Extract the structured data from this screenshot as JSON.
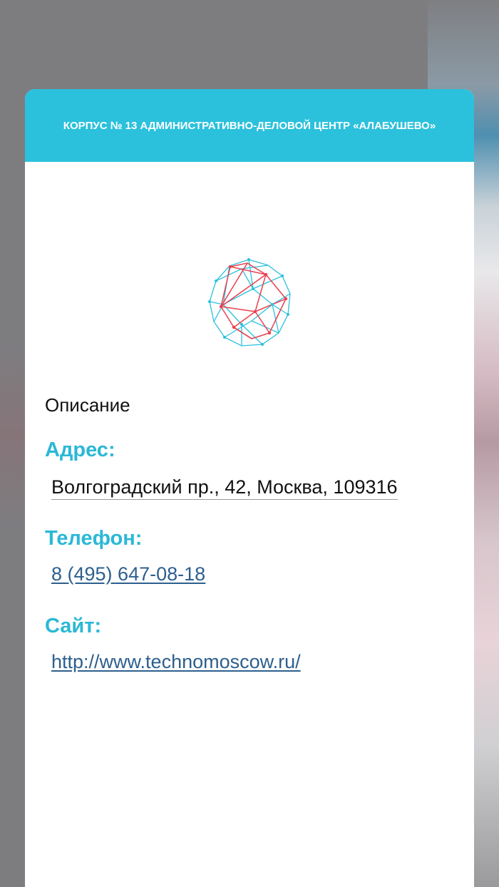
{
  "header": {
    "title": "КОРПУС № 13 АДМИНИСТРАТИВНО-ДЕЛОВОЙ ЦЕНТР «АЛАБУШЕВО»"
  },
  "logo": {
    "icon": "geodesic-sphere-logo-icon",
    "colors": [
      "#2bc1dc",
      "#e8404f"
    ]
  },
  "content": {
    "description_heading": "Описание",
    "address_label": "Адрес:",
    "address_value": "Волгоградский пр., 42, Москва, 109316",
    "phone_label": "Телефон:",
    "phone_value": "8 (495) 647-08-18",
    "site_label": "Сайт:",
    "site_value": "http://www.technomoscow.ru/"
  },
  "theme": {
    "accent": "#2bc1dc",
    "link": "#2d5f8e"
  }
}
